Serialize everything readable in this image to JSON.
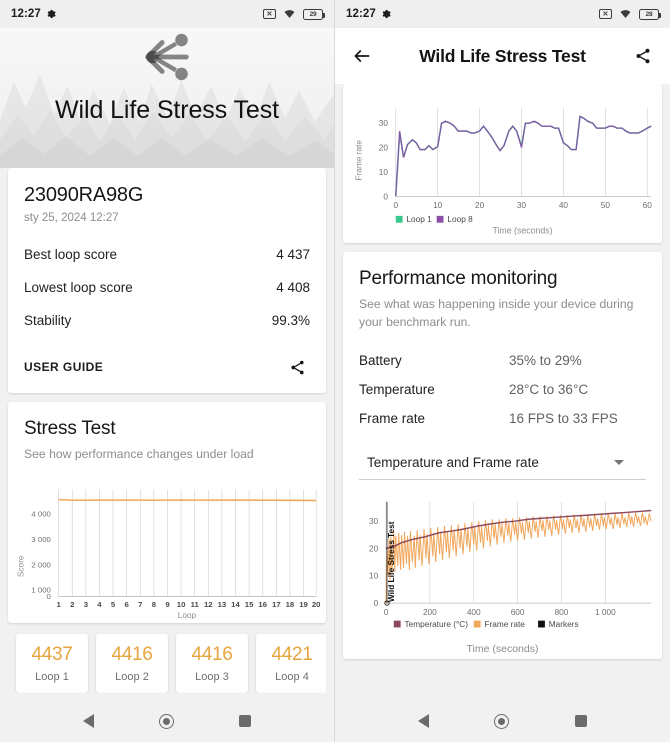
{
  "status_bar": {
    "time": "12:27",
    "gear_icon": "gear-icon",
    "sim_icon": "sim-off-icon",
    "wifi_icon": "wifi-icon",
    "battery_left": "29",
    "battery_right": "28"
  },
  "left": {
    "back_icon": "back-arrow-icon",
    "share_icon": "share-icon",
    "hero_title": "Wild Life Stress Test",
    "info": {
      "device": "23090RA98G",
      "date": "sty 25, 2024 12:27",
      "rows": [
        {
          "label": "Best loop score",
          "value": "4 437"
        },
        {
          "label": "Lowest loop score",
          "value": "4 408"
        },
        {
          "label": "Stability",
          "value": "99.3%"
        }
      ],
      "user_guide": "USER GUIDE"
    },
    "stress": {
      "title": "Stress Test",
      "subtitle": "See how performance changes under load"
    },
    "loops": [
      {
        "score": "4437",
        "label": "Loop 1"
      },
      {
        "score": "4416",
        "label": "Loop 2"
      },
      {
        "score": "4416",
        "label": "Loop 3"
      },
      {
        "score": "4421",
        "label": "Loop 4"
      },
      {
        "score": "",
        "label": ""
      }
    ]
  },
  "right": {
    "back_icon": "back-arrow-icon",
    "share_icon": "share-icon",
    "title": "Wild Life Stress Test",
    "perf": {
      "title": "Performance monitoring",
      "subtitle": "See what was happening inside your device during your benchmark run.",
      "rows": [
        {
          "label": "Battery",
          "value": "35% to 29%"
        },
        {
          "label": "Temperature",
          "value": "28°C to 36°C"
        },
        {
          "label": "Frame rate",
          "value": "16 FPS to 33 FPS"
        }
      ],
      "dropdown_value": "Temperature and Frame rate",
      "dropdown_caret_icon": "chevron-down-icon"
    }
  },
  "nav_bar": {
    "back_icon": "nav-back-icon",
    "home_icon": "nav-home-icon",
    "recents_icon": "nav-recents-icon"
  },
  "colors": {
    "loop1_green": "#35c98b",
    "loop8_purple": "#8a4fa8",
    "frame_rate_orange": "#f2a65a",
    "temperature_maroon": "#8d4a5e",
    "markers_black": "#111111",
    "score_orange": "#e8a33d"
  },
  "chart_data": [
    {
      "id": "stress-test-chart",
      "type": "line",
      "title": "Stress Test",
      "xlabel": "Loop",
      "ylabel": "Score",
      "xlim": [
        1,
        20
      ],
      "ylim": [
        0,
        4800
      ],
      "yticks": [
        0,
        1000,
        2000,
        3000,
        4000
      ],
      "ytick_labels": [
        "0",
        "1 000",
        "2 000",
        "3 000",
        "4 000"
      ],
      "xticks": [
        1,
        2,
        3,
        4,
        5,
        6,
        7,
        8,
        9,
        10,
        11,
        12,
        13,
        14,
        15,
        16,
        17,
        18,
        19,
        20
      ],
      "xtick_labels": [
        "1",
        "2",
        "3",
        "4",
        "5",
        "6",
        "7",
        "8",
        "9",
        "10",
        "11",
        "12",
        "13",
        "14",
        "15",
        "16",
        "17",
        "18",
        "19",
        "20"
      ],
      "grid": "vertical",
      "series": [
        {
          "name": "Loop score",
          "color": "#f2a65a",
          "x": [
            1,
            2,
            3,
            4,
            5,
            6,
            7,
            8,
            9,
            10,
            11,
            12,
            13,
            14,
            15,
            16,
            17,
            18,
            19,
            20
          ],
          "values": [
            4437,
            4416,
            4416,
            4421,
            4419,
            4422,
            4418,
            4415,
            4420,
            4424,
            4419,
            4417,
            4421,
            4423,
            4418,
            4416,
            4414,
            4412,
            4410,
            4408
          ]
        }
      ]
    },
    {
      "id": "frame-rate-chart",
      "type": "line",
      "title": "",
      "xlabel": "Time (seconds)",
      "ylabel": "Frame rate",
      "xlim": [
        0,
        60
      ],
      "ylim": [
        0,
        36
      ],
      "yticks": [
        0,
        10,
        20,
        30
      ],
      "ytick_labels": [
        "0",
        "10",
        "20",
        "30"
      ],
      "xticks": [
        0,
        10,
        20,
        30,
        40,
        50,
        60
      ],
      "xtick_labels": [
        "0",
        "10",
        "20",
        "30",
        "40",
        "50",
        "60"
      ],
      "grid": "vertical",
      "legend_position": "bottom-left",
      "series": [
        {
          "name": "Loop 1",
          "color": "#35c98b",
          "x": [
            0,
            1,
            2,
            3,
            4,
            5,
            6,
            7,
            8,
            9,
            10,
            11,
            12,
            13,
            14,
            15,
            16,
            17,
            18,
            19,
            20,
            21,
            22,
            23,
            24,
            25,
            26,
            27,
            28,
            29,
            30,
            31,
            32,
            33,
            34,
            35,
            36,
            37,
            38,
            39,
            40,
            41,
            42,
            43,
            44,
            45,
            46,
            47,
            48,
            49,
            50,
            51,
            52,
            53,
            54,
            55,
            56,
            57,
            58,
            59,
            60
          ],
          "values": [
            0,
            26,
            16,
            21,
            23,
            22,
            20,
            20,
            21,
            20,
            21,
            30,
            31,
            30,
            29,
            27,
            27,
            27,
            26,
            26,
            27,
            29,
            27,
            25,
            22,
            20,
            23,
            27,
            29,
            27,
            22,
            30,
            30,
            31,
            30,
            29,
            29,
            29,
            28,
            28,
            23,
            22,
            21,
            21,
            33,
            32,
            31,
            30,
            28,
            28,
            28,
            29,
            29,
            28,
            28,
            27,
            26,
            26,
            26,
            27,
            28
          ]
        },
        {
          "name": "Loop 8",
          "color": "#8a4fa8",
          "x": [
            0,
            1,
            2,
            3,
            4,
            5,
            6,
            7,
            8,
            9,
            10,
            11,
            12,
            13,
            14,
            15,
            16,
            17,
            18,
            19,
            20,
            21,
            22,
            23,
            24,
            25,
            26,
            27,
            28,
            29,
            30,
            31,
            32,
            33,
            34,
            35,
            36,
            37,
            38,
            39,
            40,
            41,
            42,
            43,
            44,
            45,
            46,
            47,
            48,
            49,
            50,
            51,
            52,
            53,
            54,
            55,
            56,
            57,
            58,
            59,
            60
          ],
          "values": [
            0,
            27,
            16,
            21,
            23,
            22,
            20,
            20,
            21,
            20,
            21,
            30,
            31,
            30,
            29,
            27,
            27,
            27,
            26,
            26,
            27,
            29,
            27,
            25,
            22,
            20,
            23,
            27,
            29,
            27,
            21,
            30,
            30,
            31,
            30,
            29,
            29,
            29,
            28,
            28,
            23,
            22,
            21,
            21,
            33,
            32,
            31,
            30,
            28,
            28,
            28,
            29,
            29,
            28,
            28,
            27,
            26,
            26,
            26,
            27,
            28
          ]
        }
      ]
    },
    {
      "id": "performance-monitoring-chart",
      "type": "line",
      "title": "",
      "xlabel": "Time (seconds)",
      "ylabel": "",
      "xlim": [
        0,
        1200
      ],
      "ylim": [
        0,
        38
      ],
      "yticks": [
        0,
        10,
        20,
        30
      ],
      "ytick_labels": [
        "0",
        "10",
        "20",
        "30"
      ],
      "xticks": [
        0,
        200,
        400,
        600,
        800,
        1000
      ],
      "xtick_labels": [
        "0",
        "200",
        "400",
        "600",
        "800",
        "1 000"
      ],
      "grid": "vertical",
      "legend_position": "bottom",
      "marker_label": "Wild Life Stress Test",
      "legend": [
        {
          "name": "Temperature (°C)",
          "color": "#8d4a5e"
        },
        {
          "name": "Frame rate",
          "color": "#f2a65a"
        },
        {
          "name": "Markers",
          "color": "#111111"
        }
      ],
      "series": [
        {
          "name": "Temperature (°C)",
          "color": "#8d4a5e",
          "x": [
            0,
            60,
            120,
            200,
            280,
            340,
            400,
            460,
            520,
            600,
            660,
            720,
            800,
            880,
            960,
            1040,
            1120,
            1180
          ],
          "values": [
            28,
            28.3,
            29,
            29.5,
            30,
            31,
            31.3,
            32,
            32.5,
            33,
            33.2,
            33.6,
            34.2,
            34.4,
            34.7,
            35,
            35.3,
            35.5
          ]
        },
        {
          "name": "Frame rate",
          "color": "#f2a65a",
          "x": [
            0,
            1200
          ],
          "values": [
            16,
            33
          ],
          "note": "high-frequency oscillation between ~16 and ~33 FPS across the run"
        }
      ]
    }
  ]
}
